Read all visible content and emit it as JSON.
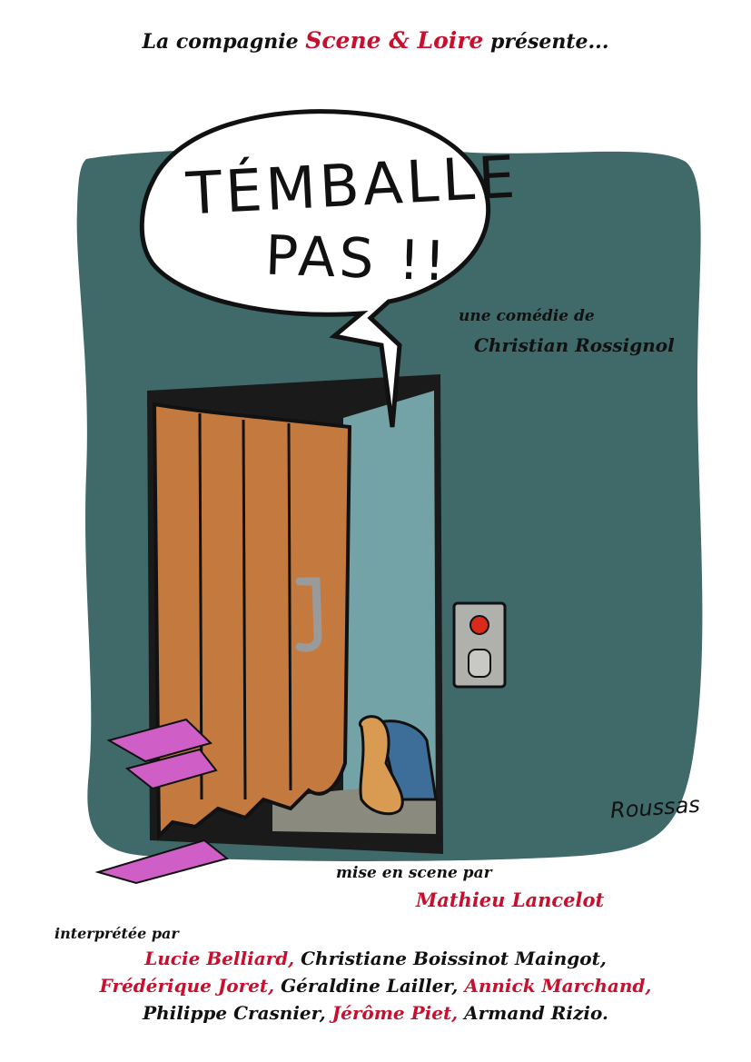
{
  "header": {
    "prefix": "La compagnie",
    "company": "Scene & Loire",
    "suffix": "présente..."
  },
  "title": {
    "line1": "TÉMBALLE",
    "line2": "PAS !!"
  },
  "credits": {
    "comedy_label": "une comédie de",
    "author": "Christian Rossignol",
    "staging_label": "mise en scene par",
    "director": "Mathieu Lancelot",
    "cast_label": "interprétée par",
    "cast_lines": [
      [
        {
          "name": "Lucie Belliard,",
          "color": "red"
        },
        {
          "name": "Christiane Boissinot  Maingot,",
          "color": "black"
        }
      ],
      [
        {
          "name": "Frédérique Joret,",
          "color": "red"
        },
        {
          "name": "Géraldine Lailler,",
          "color": "black"
        },
        {
          "name": "Annick Marchand,",
          "color": "red"
        }
      ],
      [
        {
          "name": "Philippe Crasnier,",
          "color": "black"
        },
        {
          "name": "Jérôme Piet,",
          "color": "red"
        },
        {
          "name": "Armand Rizio.",
          "color": "black"
        }
      ]
    ]
  },
  "signature": "Roussas",
  "colors": {
    "accent_red": "#c8102e",
    "wall": "#3f6a69",
    "door": "#c47a3e",
    "inside": "#73a3a6",
    "paper": "#cf5fc7"
  }
}
